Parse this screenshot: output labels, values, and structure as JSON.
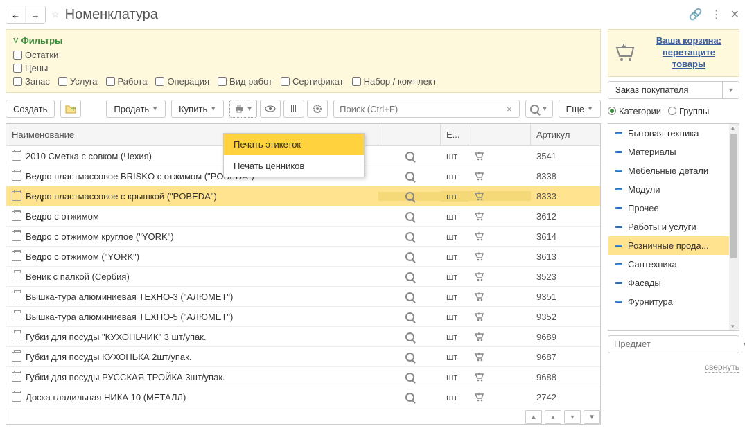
{
  "title": "Номенклатура",
  "filters": {
    "title": "Фильтры",
    "row1": {
      "c1": "Остатки",
      "c2": "Цены"
    },
    "row2": {
      "c1": "Запас",
      "c2": "Услуга",
      "c3": "Работа",
      "c4": "Операция",
      "c5": "Вид работ",
      "c6": "Сертификат",
      "c7": "Набор / комплект"
    }
  },
  "toolbar": {
    "create": "Создать",
    "sell": "Продать",
    "buy": "Купить",
    "more": "Еще"
  },
  "search": {
    "placeholder": "Поиск (Ctrl+F)"
  },
  "popup": {
    "i1": "Печать этикеток",
    "i2": "Печать ценников"
  },
  "columns": {
    "name": "Наименование",
    "unit": "Е...",
    "art": "Артикул"
  },
  "rows": [
    {
      "name": "2010 Сметка с совком (Чехия)",
      "unit": "шт",
      "art": "3541",
      "sel": false
    },
    {
      "name": "Ведро пластмассовое BRISKO с отжимом (\"POBEDA\")",
      "unit": "шт",
      "art": "8338",
      "sel": false
    },
    {
      "name": "Ведро пластмассовое с крышкой (\"POBEDA\")",
      "unit": "шт",
      "art": "8333",
      "sel": true
    },
    {
      "name": "Ведро с отжимом",
      "unit": "шт",
      "art": "3612",
      "sel": false
    },
    {
      "name": "Ведро с отжимом  круглое (\"YORK\")",
      "unit": "шт",
      "art": "3614",
      "sel": false
    },
    {
      "name": "Ведро с отжимом (\"YORK\")",
      "unit": "шт",
      "art": "3613",
      "sel": false
    },
    {
      "name": "Веник с палкой (Сербия)",
      "unit": "шт",
      "art": "3523",
      "sel": false
    },
    {
      "name": "Вышка-тура алюминиевая ТЕХНО-3 (\"АЛЮМЕТ\")",
      "unit": "шт",
      "art": "9351",
      "sel": false
    },
    {
      "name": "Вышка-тура алюминиевая ТЕХНО-5 (\"АЛЮМЕТ\")",
      "unit": "шт",
      "art": "9352",
      "sel": false
    },
    {
      "name": "Губки для посуды \"КУХОНЬЧИК\" 3 шт/упак.",
      "unit": "шт",
      "art": "9689",
      "sel": false
    },
    {
      "name": "Губки для посуды КУХОНЬКА 2шт/упак.",
      "unit": "шт",
      "art": "9687",
      "sel": false
    },
    {
      "name": "Губки для посуды РУССКАЯ ТРОЙКА 3шт/упак.",
      "unit": "шт",
      "art": "9688",
      "sel": false
    },
    {
      "name": "Доска гладильная  НИКА 10 (МЕТАЛЛ)",
      "unit": "шт",
      "art": "2742",
      "sel": false
    }
  ],
  "cart": {
    "line1": "Ваша корзина:",
    "line2": "перетащите товары",
    "order": "Заказ покупателя"
  },
  "radios": {
    "r1": "Категории",
    "r2": "Группы"
  },
  "cats": [
    {
      "name": "Бытовая техника",
      "sel": false
    },
    {
      "name": "Материалы",
      "sel": false
    },
    {
      "name": "Мебельные детали",
      "sel": false
    },
    {
      "name": "Модули",
      "sel": false
    },
    {
      "name": "Прочее",
      "sel": false
    },
    {
      "name": "Работы и услуги",
      "sel": false
    },
    {
      "name": "Розничные прода...",
      "sel": true
    },
    {
      "name": "Сантехника",
      "sel": false
    },
    {
      "name": "Фасады",
      "sel": false
    },
    {
      "name": "Фурнитура",
      "sel": false
    }
  ],
  "subject": {
    "placeholder": "Предмет"
  },
  "collapse": "свернуть"
}
